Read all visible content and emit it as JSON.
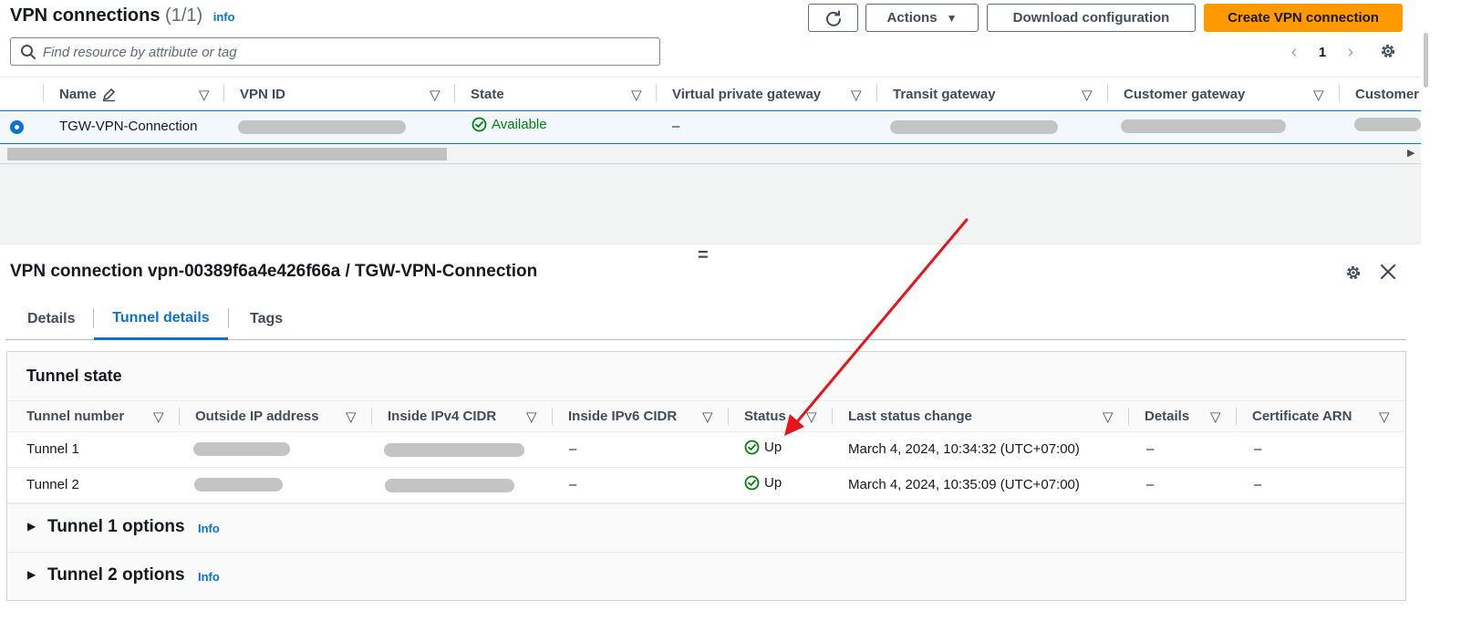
{
  "header": {
    "title": "VPN connections",
    "count": "(1/1)",
    "info_label": "info",
    "refresh_icon": "refresh-icon",
    "actions_label": "Actions",
    "download_label": "Download configuration",
    "create_label": "Create VPN connection"
  },
  "search": {
    "placeholder": "Find resource by attribute or tag"
  },
  "pagination": {
    "page": "1"
  },
  "table": {
    "columns": [
      "Name",
      "VPN ID",
      "State",
      "Virtual private gateway",
      "Transit gateway",
      "Customer gateway",
      "Customer"
    ],
    "rows": [
      {
        "name": "TGW-VPN-Connection",
        "state": "Available",
        "virtual_private_gateway": "–"
      }
    ]
  },
  "detail": {
    "title": "VPN connection vpn-00389f6a4e426f66a / TGW-VPN-Connection",
    "tabs": [
      "Details",
      "Tunnel details",
      "Tags"
    ],
    "active_tab": "Tunnel details",
    "tunnel_state": {
      "title": "Tunnel state",
      "columns": [
        "Tunnel number",
        "Outside IP address",
        "Inside IPv4 CIDR",
        "Inside IPv6 CIDR",
        "Status",
        "Last status change",
        "Details",
        "Certificate ARN"
      ],
      "rows": [
        {
          "tunnel": "Tunnel 1",
          "inside_ipv6": "–",
          "status": "Up",
          "last_change": "March 4, 2024, 10:34:32 (UTC+07:00)",
          "details": "–",
          "cert": "–"
        },
        {
          "tunnel": "Tunnel 2",
          "inside_ipv6": "–",
          "status": "Up",
          "last_change": "March 4, 2024, 10:35:09 (UTC+07:00)",
          "details": "–",
          "cert": "–"
        }
      ]
    },
    "sections": [
      {
        "label": "Tunnel 1 options",
        "info": "Info"
      },
      {
        "label": "Tunnel 2 options",
        "info": "Info"
      }
    ]
  },
  "colors": {
    "primary": "#ff9900",
    "link": "#0972d3",
    "success": "#037f0c",
    "annotation_arrow": "#e8141b"
  }
}
